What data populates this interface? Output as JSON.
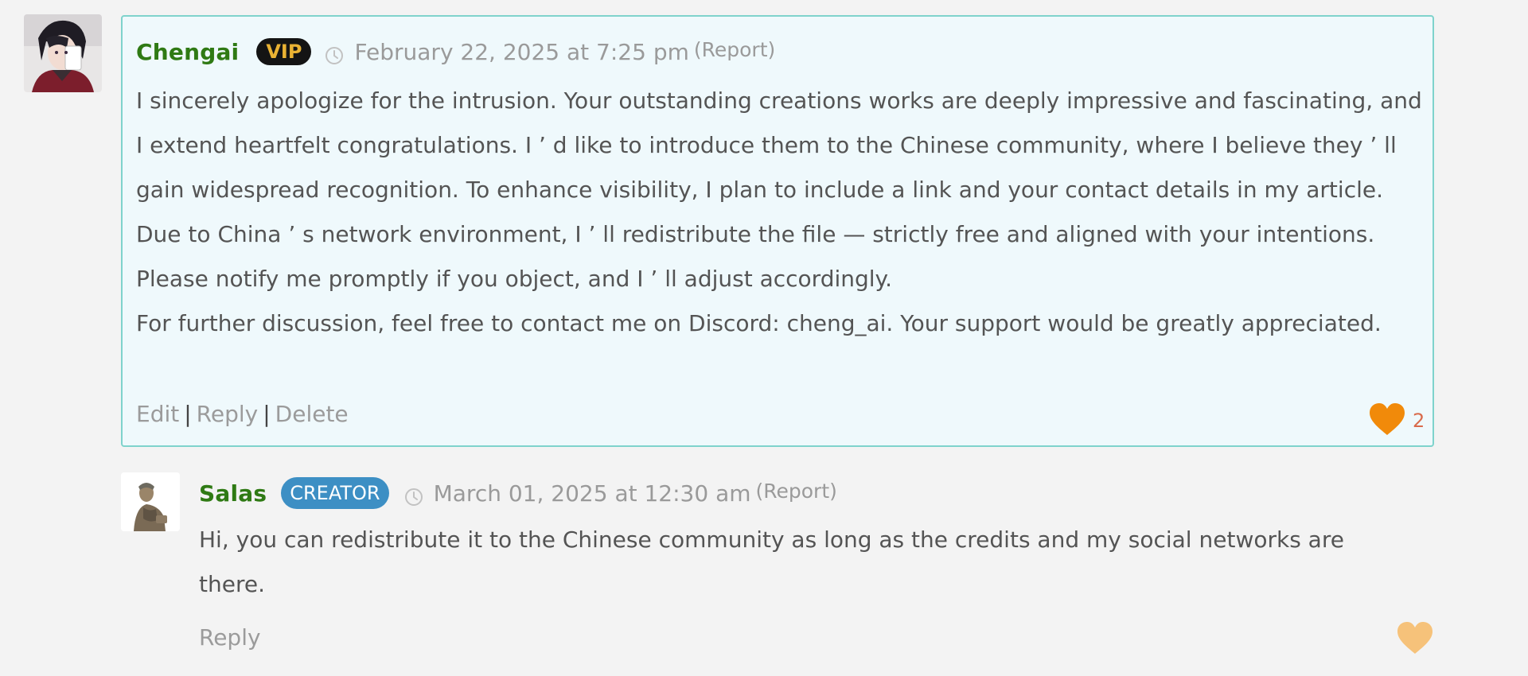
{
  "comments": [
    {
      "author": "Chengai",
      "badge": "VIP",
      "date": "February 22, 2025 at 7:25 pm",
      "report": "(Report)",
      "paragraphs": [
        "I sincerely apologize for the intrusion. Your outstanding creations works are deeply impressive and fascinating, and I extend heartfelt congratulations. I ’ d like to introduce them to the Chinese community, where I believe they ’ ll gain widespread recognition. To enhance visibility, I plan to include a link and your contact details in my article. Due to China ’ s network environment, I ’ ll redistribute the file — strictly free and aligned with your intentions. Please notify me promptly if you object, and I ’ ll adjust accordingly.",
        "For further discussion, feel free to contact me on Discord: cheng_ai. Your support would be greatly appreciated."
      ],
      "actions": {
        "edit": "Edit",
        "reply": "Reply",
        "delete": "Delete",
        "separator": "|"
      },
      "likes": "2",
      "heart_color": "#f18a0a"
    },
    {
      "author": "Salas",
      "badge": "CREATOR",
      "date": "March 01, 2025 at 12:30 am",
      "report": "(Report)",
      "paragraphs": [
        "Hi, you can redistribute it to the Chinese community as long as the credits and my social networks are there."
      ],
      "actions": {
        "reply": "Reply"
      },
      "heart_color": "#f6c27a"
    }
  ],
  "colors": {
    "author_name": "#2f7a14",
    "vip_badge_bg": "#141414",
    "vip_badge_text": "#e9b233",
    "creator_badge_bg": "#3d8fc4",
    "highlight_bg": "#eff9fc",
    "highlight_border": "#7fd3cc"
  },
  "icons": {
    "clock": "clock-icon",
    "like": "heart-icon",
    "avatar_1": "avatar-chengai",
    "avatar_2": "avatar-salas"
  }
}
